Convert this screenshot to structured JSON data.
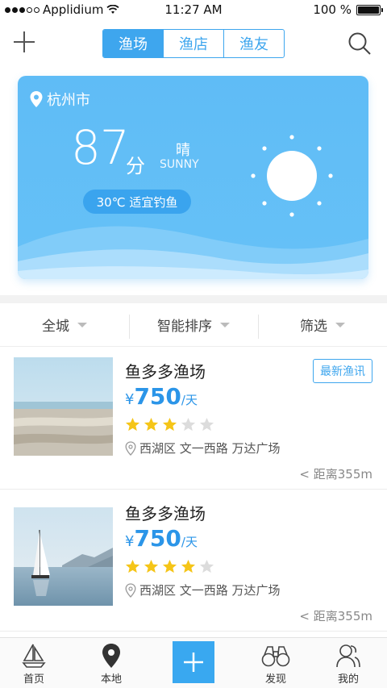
{
  "status_bar": {
    "carrier": "Applidium",
    "time": "11:27 AM",
    "battery": "100 %",
    "battery_level": 1.0
  },
  "nav": {
    "tabs": [
      "渔场",
      "渔店",
      "渔友"
    ],
    "active_tab": 0
  },
  "weather": {
    "city": "杭州市",
    "score": "87",
    "score_unit": "分",
    "condition": "晴",
    "condition_en": "SUNNY",
    "advice": "30℃ 适宜钓鱼"
  },
  "filters": [
    "全城",
    "智能排序",
    "筛选"
  ],
  "listings": [
    {
      "name": "鱼多多渔场",
      "badge": "最新渔讯",
      "currency": "¥",
      "price": "750",
      "unit": "/天",
      "rating": 3,
      "rating_max": 5,
      "address": "西湖区 文一西路 万达广场",
      "distance": "< 距离355m",
      "image": "beach-photo"
    },
    {
      "name": "鱼多多渔场",
      "badge": "",
      "currency": "¥",
      "price": "750",
      "unit": "/天",
      "rating": 4,
      "rating_max": 5,
      "address": "西湖区 文一西路 万达广场",
      "distance": "< 距离355m",
      "image": "sailboat-photo"
    }
  ],
  "tabbar": {
    "home": "首页",
    "local": "本地",
    "discover": "发现",
    "mine": "我的"
  },
  "colors": {
    "accent": "#3ea6ee",
    "star_on": "#f5c518",
    "star_off": "#dcdcdc",
    "card": "#62bff6"
  }
}
